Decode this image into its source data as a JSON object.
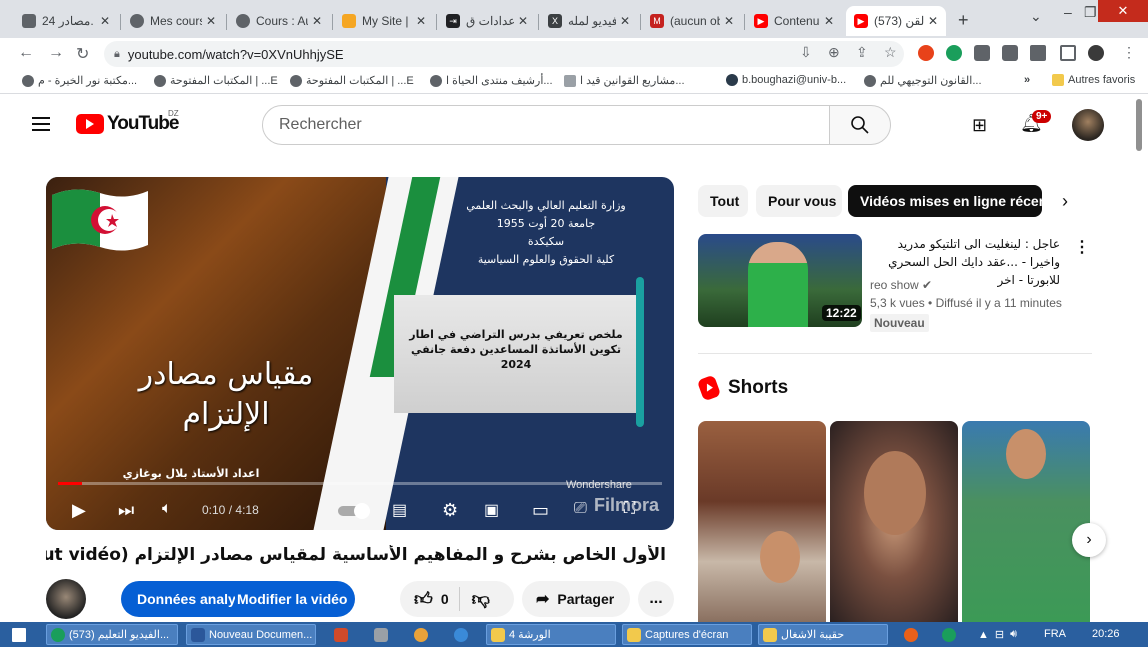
{
  "browser": {
    "tabs": [
      {
        "label": "مصادر 24.",
        "icon_color": "#5f6368"
      },
      {
        "label": "Mes cours",
        "icon_color": "#5f6368"
      },
      {
        "label": "Cours : Au",
        "icon_color": "#5f6368"
      },
      {
        "label": "My Site | F",
        "icon_color": "#f5a623"
      },
      {
        "label": "إعدادات ق",
        "icon_color": "#202124"
      },
      {
        "label": "فيديو لمله",
        "icon_color": "#3c4043"
      },
      {
        "label": "(aucun ob",
        "icon_color": "#c5221f"
      },
      {
        "label": "Contenu d",
        "icon_color": "#ff0000"
      },
      {
        "label": "(573) القن",
        "icon_color": "#ff0000",
        "active": true
      }
    ],
    "new_tab": "+",
    "url": "youtube.com/watch?v=0XVnUhhjySE",
    "bookmarks": [
      "مكتبة نور الخيرة - م...",
      "المكتبات المفتوحة | ...E",
      "المكتبات المفتوحة | ...E",
      "أرشيف منتدى الحياة ا...",
      "مشاريع القوانين قيد ا...",
      "b.boughazi@univ-b...",
      "القانون التوجيهي للم...",
      "»",
      "Autres favoris"
    ]
  },
  "youtube": {
    "logo_text": "YouTube",
    "country_code": "DZ",
    "search_placeholder": "Rechercher",
    "notification_count": "9+",
    "player": {
      "slide_ministry": "وزارة التعليم العالي والبحث العلمي\nجامعة 20 أوت 1955\nسكيكدة\nكلية الحقوق والعلوم السياسية",
      "slide_title": "مقياس مصادر الإلتزام",
      "slide_summary": "ملخص تعريفي بدرس التراضي في اطار تكوين الأساتذة المساعدين دفعة جانفي 2024",
      "slide_author": "اعداد الأستاذ بلال بوغازي",
      "watermark_brand": "Wondershare",
      "watermark_product": "Filmora",
      "time_current": "0:10",
      "time_separator": "/",
      "time_total": "4:18",
      "progress_fraction": 0.039
    },
    "video_title": "الأول الخاص بشرح و المفاهيم الأساسية لمقياس مصادر الإلتزام (about vidéo)الفيديو التعليمي",
    "actions": {
      "analytics_label": "Données analytiques",
      "edit_label": "Modifier la vidéo",
      "like_count": "0",
      "share_label": "Partager",
      "more_label": "..."
    },
    "chips": [
      "Tout",
      "Pour vous",
      "Vidéos mises en ligne récemment"
    ],
    "recommended": {
      "title": "عاجل : لينغليت الى اتلتيكو مدريد واخيرا - ...عقد دايك الحل السحري للابورتا - اخر",
      "channel": "reo show",
      "views": "5,3 k vues",
      "posted": "Diffusé il y a 11 minutes",
      "meta_separator": "•",
      "badge": "Nouveau",
      "duration": "12:22"
    },
    "shorts_heading": "Shorts"
  },
  "taskbar": {
    "items": [
      "(573) الفيديو التعليم...",
      "Nouveau Documen...",
      "الورشة 4",
      "Captures d'écran",
      "حقيبة الاشغال"
    ],
    "language": "FRA",
    "clock": "20:26"
  },
  "colors": {
    "brand_red": "#ff0000",
    "primary_blue": "#065fd4",
    "taskbar_blue": "#2a5f9f"
  }
}
